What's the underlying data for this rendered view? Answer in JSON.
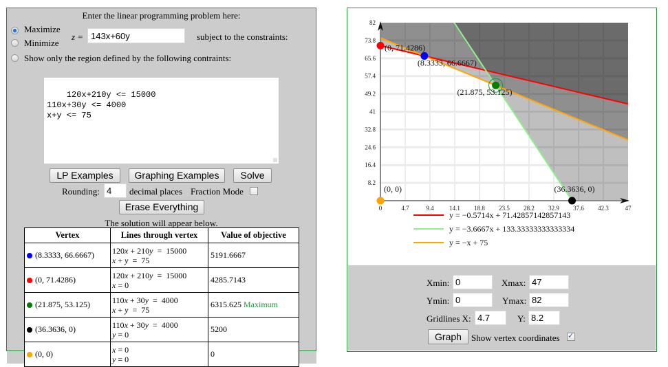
{
  "problem": {
    "heading": "Enter the linear programming problem here:",
    "modes": [
      {
        "label": "Maximize",
        "checked": true
      },
      {
        "label": "Minimize",
        "checked": false
      },
      {
        "label": "Show only the region defined by the following contraints:",
        "checked": false
      }
    ],
    "z_label": "z =",
    "objective": "143x+60y",
    "subject_to": "subject to the constraints:",
    "constraints": "120x+210y <= 15000\n110x+30y <= 4000\nx+y <= 75"
  },
  "buttons": {
    "lp_examples": "LP Examples",
    "graphing_examples": "Graphing Examples",
    "solve": "Solve",
    "erase": "Erase Everything",
    "graph": "Graph"
  },
  "rounding": {
    "label": "Rounding:",
    "value": "4",
    "suffix": "decimal places",
    "fraction_label": "Fraction Mode",
    "fraction_checked": false
  },
  "solution": {
    "note": "The solution will appear below.",
    "headers": [
      "Vertex",
      "Lines through vertex",
      "Value of objective"
    ],
    "rows": [
      {
        "color": "#0000ff",
        "vertex": "(8.3333, 66.6667)",
        "line1": "120x + 210y  =  15000",
        "line2": "x + y  =  75",
        "value": "5191.6667",
        "tag": ""
      },
      {
        "color": "#ff0000",
        "vertex": "(0, 71.4286)",
        "line1": "120x + 210y  =  15000",
        "line2": "x = 0",
        "value": "4285.7143",
        "tag": ""
      },
      {
        "color": "#008000",
        "vertex": "(21.875, 53.125)",
        "line1": "110x + 30y  =  4000",
        "line2": "x + y  =  75",
        "value": "6315.625",
        "tag": "Maximum"
      },
      {
        "color": "#000000",
        "vertex": "(36.3636, 0)",
        "line1": "110x + 30y  =  4000",
        "line2": "y = 0",
        "value": "5200",
        "tag": ""
      },
      {
        "color": "#ffa500",
        "vertex": "(0, 0)",
        "line1": "x = 0",
        "line2": "y = 0",
        "value": "0",
        "tag": ""
      }
    ]
  },
  "graph_controls": {
    "xmin_label": "Xmin:",
    "xmin": "0",
    "xmax_label": "Xmax:",
    "xmax": "47",
    "ymin_label": "Ymin:",
    "ymin": "0",
    "ymax_label": "Ymax:",
    "ymax": "82",
    "gridx_label": "Gridlines X:",
    "gridx": "4.7",
    "gridy_label": "Y:",
    "gridy": "8.2",
    "show_vertex_label": "Show vertex coordinates",
    "show_vertex_checked": true
  },
  "chart_data": {
    "type": "line",
    "title": "",
    "xlim": [
      0,
      47
    ],
    "ylim": [
      0,
      82
    ],
    "x_ticks": [
      "0",
      "4.7",
      "9.4",
      "14.1",
      "18.8",
      "23.5",
      "28.2",
      "32.9",
      "37.6",
      "42.3",
      "47"
    ],
    "y_ticks": [
      "8.2",
      "16.4",
      "24.6",
      "32.8",
      "41",
      "49.2",
      "57.4",
      "65.6",
      "73.8",
      "82"
    ],
    "grid": true,
    "series": [
      {
        "name": "y = −0.5714x + 71.42857142857143",
        "color": "#ff0000",
        "slope": -0.5714285714,
        "intercept": 71.42857142857143
      },
      {
        "name": "y = −3.6667x + 133.33333333333334",
        "color": "#90ee90",
        "slope": -3.6666666667,
        "intercept": 133.33333333333334
      },
      {
        "name": "y = −x + 75",
        "color": "#ffa500",
        "slope": -1,
        "intercept": 75
      }
    ],
    "vertices": [
      {
        "x": 0,
        "y": 71.4286,
        "label": "(0, 71.4286)",
        "color": "#ff0000"
      },
      {
        "x": 8.3333,
        "y": 66.6667,
        "label": "(8.3333, 66.6667)",
        "color": "#0000ff"
      },
      {
        "x": 21.875,
        "y": 53.125,
        "label": "(21.875, 53.125)",
        "color": "#008000",
        "optimal": true
      },
      {
        "x": 36.3636,
        "y": 0,
        "label": "(36.3636, 0)",
        "color": "#000000"
      },
      {
        "x": 0,
        "y": 0,
        "label": "(0, 0)",
        "color": "#ffa500"
      }
    ],
    "legend": [
      "y = −0.5714x + 71.42857142857143",
      "y = −3.6667x + 133.33333333333334",
      "y = −x + 75"
    ],
    "legend_position": "bottom"
  }
}
